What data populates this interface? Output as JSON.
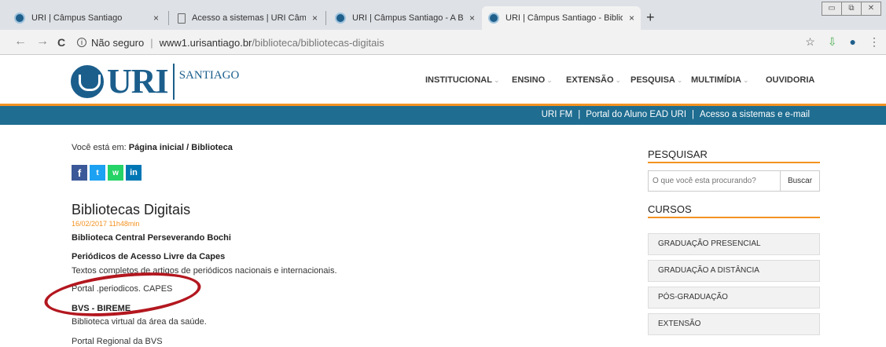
{
  "browser": {
    "tabs": [
      {
        "title": "URI | Câmpus Santiago",
        "close": "×"
      },
      {
        "title": "Acesso a sistemas | URI Câmpus Sa",
        "close": "×"
      },
      {
        "title": "URI | Câmpus Santiago - A Bibliotec",
        "close": "×"
      },
      {
        "title": "URI | Câmpus Santiago - Bibliotecas",
        "close": "×"
      }
    ],
    "new_tab": "+",
    "window_controls": [
      "▭",
      "⧉",
      "✕"
    ],
    "nav": {
      "back": "←",
      "forward": "→",
      "reload": "C"
    },
    "info_icon": "i",
    "security": "Não seguro",
    "address_host": "www1.urisantiago.br",
    "address_path": "/biblioteca/bibliotecas-digitais",
    "toolbar_icons": [
      "☆",
      "⇩",
      "●",
      "⋮"
    ]
  },
  "site": {
    "logo_text": "URI",
    "logo_sub": "SANTIAGO",
    "nav": [
      {
        "label": "INSTITUCIONAL",
        "caret": "⌄"
      },
      {
        "label": "ENSINO",
        "caret": "⌄"
      },
      {
        "label": "EXTENSÃO",
        "caret": "⌄"
      },
      {
        "label": "PESQUISA",
        "caret": "⌄"
      },
      {
        "label": "MULTIMÍDIA",
        "caret": "⌄"
      },
      {
        "label": "OUVIDORIA",
        "caret": ""
      }
    ],
    "topbar_links": [
      "URI FM",
      "Portal do Aluno EAD URI",
      "Acesso a sistemas e e-mail"
    ],
    "topbar_sep": "|"
  },
  "content": {
    "breadcrumb_prefix": "Você está em:",
    "breadcrumb": "Página inicial / Biblioteca",
    "share": [
      "f",
      "t",
      "w",
      "in"
    ],
    "title": "Bibliotecas Digitais",
    "date": "16/02/2017 11h48min",
    "subtitle": "Biblioteca Central Perseverando Bochi",
    "capes_heading": "Periódicos de Acesso Livre da Capes",
    "capes_desc": "Textos completos de artigos de periódicos nacionais e internacionais.",
    "capes_link": "Portal .periodicos. CAPES",
    "bvs_heading": "BVS - BIREME",
    "bvs_desc": "Biblioteca virtual da área da saúde.",
    "bvs_link": "Portal Regional da BVS"
  },
  "sidebar": {
    "search_heading": "PESQUISAR",
    "search_placeholder": "O que você esta procurando?",
    "search_button": "Buscar",
    "courses_heading": "CURSOS",
    "courses": [
      "GRADUAÇÃO PRESENCIAL",
      "GRADUAÇÃO A DISTÂNCIA",
      "PÓS-GRADUAÇÃO",
      "EXTENSÃO"
    ]
  }
}
